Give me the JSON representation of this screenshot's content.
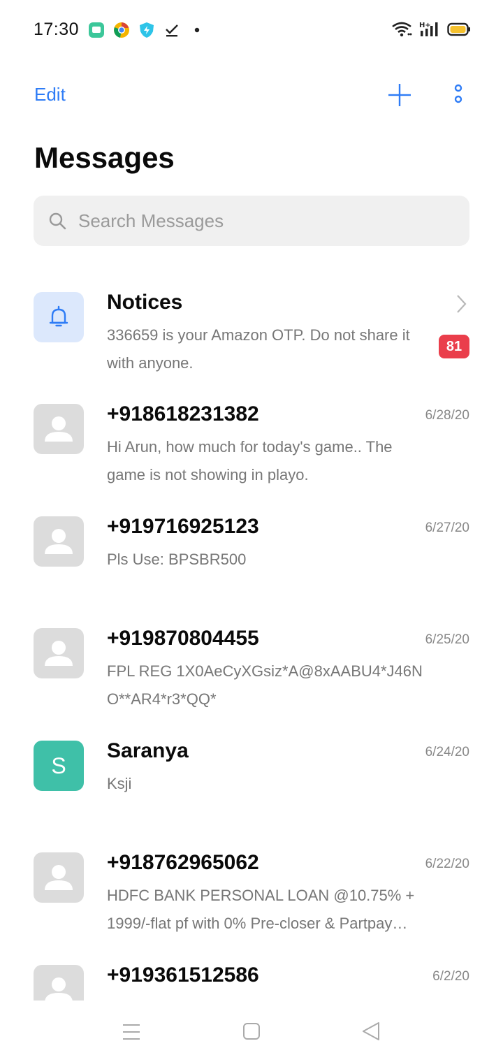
{
  "status_bar": {
    "time": "17:30",
    "left_icons": [
      "message-app-icon",
      "chrome-icon",
      "shield-bolt-icon",
      "download-done-icon",
      "dot-icon"
    ],
    "right_icons": [
      "wifi-icon",
      "signal-h-plus-icon",
      "battery-icon"
    ]
  },
  "toolbar": {
    "edit_label": "Edit",
    "accent_color": "#2e7cf6"
  },
  "page": {
    "title": "Messages"
  },
  "search": {
    "placeholder": "Search Messages"
  },
  "conversations": [
    {
      "title": "Notices",
      "snippet": "336659 is your Amazon OTP. Do not share it with anyone.",
      "badge": "81",
      "avatar": "bell-icon"
    },
    {
      "title": "+918618231382",
      "date": "6/28/20",
      "snippet": "Hi Arun, how much for today's game.. The game is not showing in playo.",
      "avatar": "person-icon"
    },
    {
      "title": "+919716925123",
      "date": "6/27/20",
      "snippet": "Pls Use: BPSBR500",
      "avatar": "person-icon"
    },
    {
      "title": "+919870804455",
      "date": "6/25/20",
      "snippet": "FPL REG 1X0AeCyXGsiz*A@8xAABU4*J46N O**AR4*r3*QQ*",
      "avatar": "person-icon"
    },
    {
      "title": "Saranya",
      "date": "6/24/20",
      "snippet": "Ksji",
      "avatar_letter": "S"
    },
    {
      "title": "+918762965062",
      "date": "6/22/20",
      "snippet": "HDFC BANK PERSONAL LOAN @10.75% + 1999/-flat pf with 0% Pre-closer & Partpay…",
      "avatar": "person-icon"
    },
    {
      "title": "+919361512586",
      "date": "6/2/20",
      "snippet": "",
      "avatar": "person-icon"
    }
  ],
  "nav_bar": {
    "buttons": [
      "menu-icon",
      "home-square-icon",
      "back-triangle-icon"
    ]
  }
}
